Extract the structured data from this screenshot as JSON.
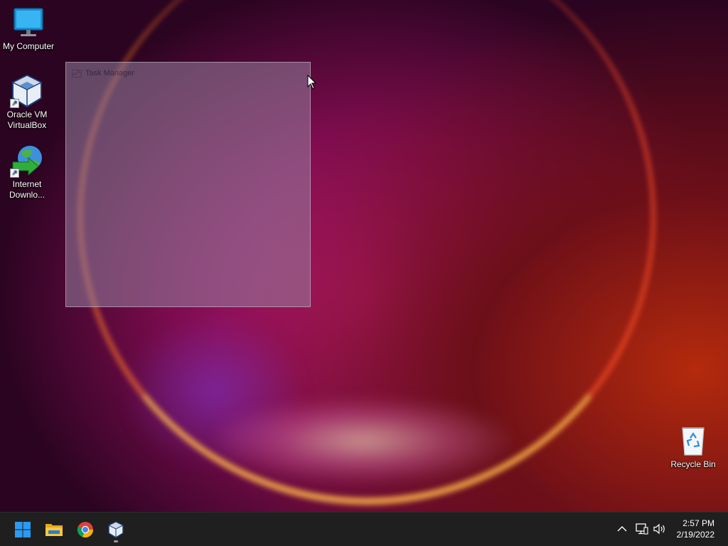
{
  "desktop": {
    "icons": [
      {
        "label": "My Computer",
        "icon": "monitor-icon"
      },
      {
        "label": "Oracle VM VirtualBox",
        "icon": "virtualbox-icon"
      },
      {
        "label": "Internet Downlo...",
        "icon": "internet-download-manager-icon"
      },
      {
        "label": "Recycle Bin",
        "icon": "recycle-bin-icon"
      }
    ]
  },
  "task_manager_window": {
    "title": "Task Manager",
    "icon": "task-manager-icon"
  },
  "taskbar": {
    "apps": [
      {
        "name": "Start",
        "icon": "windows-start-icon"
      },
      {
        "name": "File Explorer",
        "icon": "folder-icon"
      },
      {
        "name": "Google Chrome",
        "icon": "chrome-icon"
      },
      {
        "name": "VirtualBox",
        "icon": "virtualbox-icon"
      }
    ],
    "tray": {
      "icons": [
        "chevron-up-icon",
        "network-icon",
        "volume-icon"
      ]
    },
    "clock": {
      "time": "2:57 PM",
      "date": "2/19/2022"
    }
  },
  "colors": {
    "taskbar": "#1f1f1f",
    "start_blue": "#2b9af3",
    "wallpaper_magenta": "#c01a7a",
    "wallpaper_orange": "#ffb54a"
  }
}
